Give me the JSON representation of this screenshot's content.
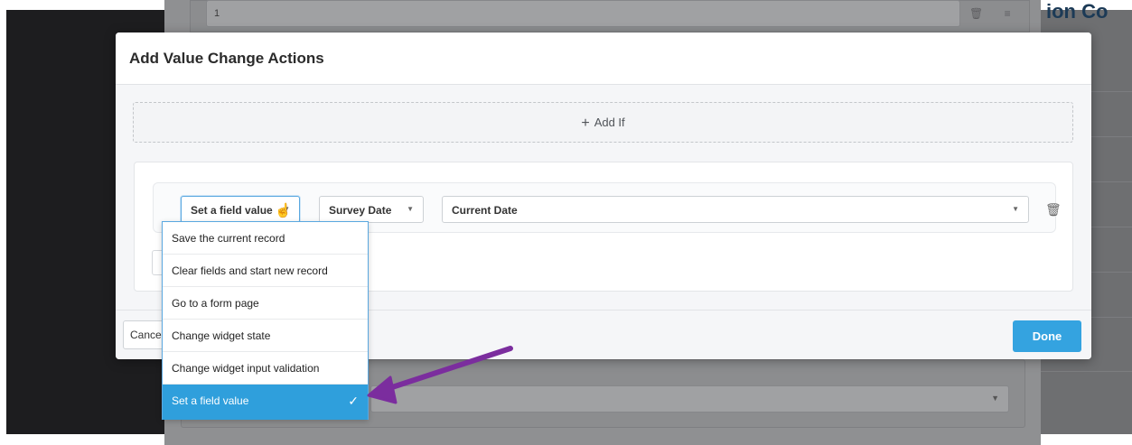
{
  "background": {
    "top_input_value": "1",
    "top_icons": "🗑 ≡"
  },
  "modal": {
    "title": "Add Value Change Actions",
    "add_if_label": "Add If",
    "action": {
      "action_select": "Set a field value",
      "field_select": "Survey Date",
      "value_select": "Current Date"
    },
    "footer": {
      "cancel_label": "Cancel",
      "done_label": "Done"
    }
  },
  "dropdown": {
    "options": [
      "Save the current record",
      "Clear fields and start new record",
      "Go to a form page",
      "Change widget state",
      "Change widget input validation",
      "Set a field value"
    ],
    "selected": "Set a field value"
  },
  "colors": {
    "accent": "#34a3e0",
    "annotation_arrow": "#7b2d9e"
  }
}
